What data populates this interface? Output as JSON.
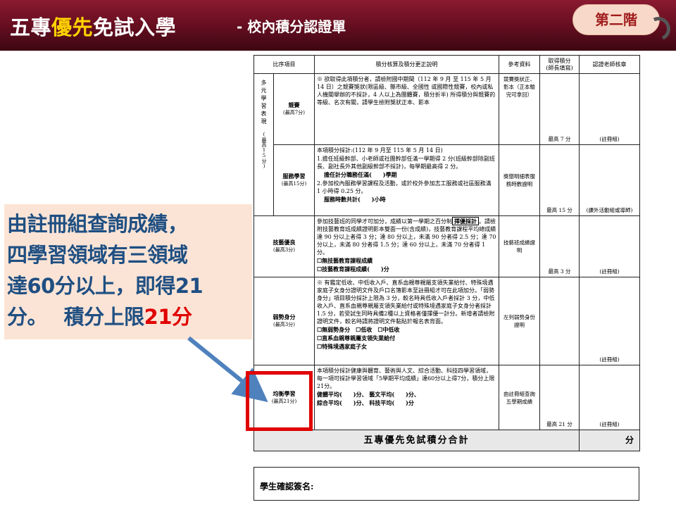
{
  "title": {
    "part1": "五專",
    "highlight": "優先",
    "part2": "免試入學",
    "subtitle": "- 校內積分認證單",
    "badge": "第二階"
  },
  "table": {
    "headers": {
      "item": "比序項目",
      "description": "積分核算及積分更正說明",
      "reference": "參考資料",
      "points_line1": "取得積分",
      "points_line2": "(師長填寫)",
      "teacher": "認證老師核章"
    },
    "group_label": "多元學習表現",
    "group_max": "(最高15分)",
    "rows": {
      "competition": {
        "name": "競賽",
        "max": "(最高7分)",
        "desc": "※ 欲取得此項積分者，請檢附國中期間（112 年 9 月 至 115 年 5 月 14 日）之競賽獎狀(限區級、縣市級、全國性 或國際性競賽，校內或私人機關舉辦的不採計，4 人以上為團體賽，積分折半) 所得積分與競賽的等級、名次有關，請學生檢附獎狀正本、影本",
        "ref": "競賽獎狀正、影本（正本驗完可拿回）",
        "score": "最高 7 分",
        "sign": "(註冊組)"
      },
      "service": {
        "name": "服務學習",
        "max": "(最高15分)",
        "desc_1": "本項積分採計:(112 年 9 月至 115 年 5 月 14 日)",
        "desc_2": "1.擔任班級幹部、小老師或社團幹部任滿一學期得 2 分(班級幹部除副班長、副社長外其他副級幹部不採計)，每學期最高得 2 分。",
        "desc_3": "擔任計分職務任滿(　　)學期",
        "desc_4": "2.參加校內服務學習課程及活動，或於校外參加志工服務或社區服務滿 1 小時得 0.25 分。",
        "desc_5": "服務時數共計(　　)小時",
        "ref": "獎懲明細表服務時數證明",
        "score": "最高 15 分",
        "sign": "(課外活動組或導師)"
      },
      "skill": {
        "name": "技藝優良",
        "max": "(最高3分)",
        "desc_1": "參加技藝班的同學才可加分，成績以第一學期之百分制",
        "desc_boxed": "擇優採計",
        "desc_2": "。請檢附技藝教育班成績證明影本雙面一份(含成績)，技藝教育課程平均總成績達 90 分以上者得 3 分；達 80 分以上，未滿 90 分者得 2.5 分；達 70 分以上，未滿 80 分者得 1.5 分；達 60 分以上，未滿 70 分者得 1 分。",
        "opt_1": "☐無技藝教育課程成績",
        "opt_2": "☐技藝教育課程成績(　　)分",
        "ref": "技藝班成績證明",
        "score": "最高 3 分",
        "sign": "(註冊組)"
      },
      "disadvantaged": {
        "name": "弱勢身分",
        "max": "(最高3分)",
        "desc_1": "※ 有鑑定低收、中低收入戶、直系血親尊親屬支領失業給付、特殊境遇家庭子女身分證明文件及戶口名簿影本至註冊組才可在此項加分。「弱勢身分」項目積分採計上限為 3 分，較名時具低收入戶者採計 3 分，中低收入戶、直系血親尊親屬支領失業給付或特殊境遇家庭子女身分者採計 1.5 分，若受試生同時具備2種以上資格者僅擇優一計分。新增者請檢附證明文件，較名時請將證明文件黏貼於報名表背面。",
        "opt_1": "☐無弱勢身分　☐低收　☐中低收",
        "opt_2": "☐直系血親尊親屬支領失業給付",
        "opt_3": "☐特殊境遇家庭子女",
        "ref": "左列弱勢身份證明",
        "score": "",
        "sign": "(註冊組)"
      },
      "balanced": {
        "name": "均衡學習",
        "max": "(最高21分)",
        "desc_1": "本項積分採計健康與體育、藝術與人文、綜合活動、科技四學習領域，每一項可採計學習領域「5學期平均成績」達60分以上得7分，積分上限21分。",
        "line_1": "健體平均(　　)分、 藝文平均(　　)分、",
        "line_2": "綜合平均(　　)分、 科技平均(　　)分",
        "ref": "由註冊組查詢五學期成績",
        "score": "最高 21 分",
        "sign": "(註冊組)"
      }
    },
    "total": {
      "label": "五專優先免試積分合計",
      "unit": "分"
    }
  },
  "signature_label": "學生確認簽名:",
  "callout": {
    "line_1": "由註冊組查詢成績，",
    "line_2": "四學習領域有三領域",
    "line_3": "達60分以上，即得21",
    "line_4a": "分。",
    "line_4b": "積分上限",
    "line_4c": "21分"
  }
}
